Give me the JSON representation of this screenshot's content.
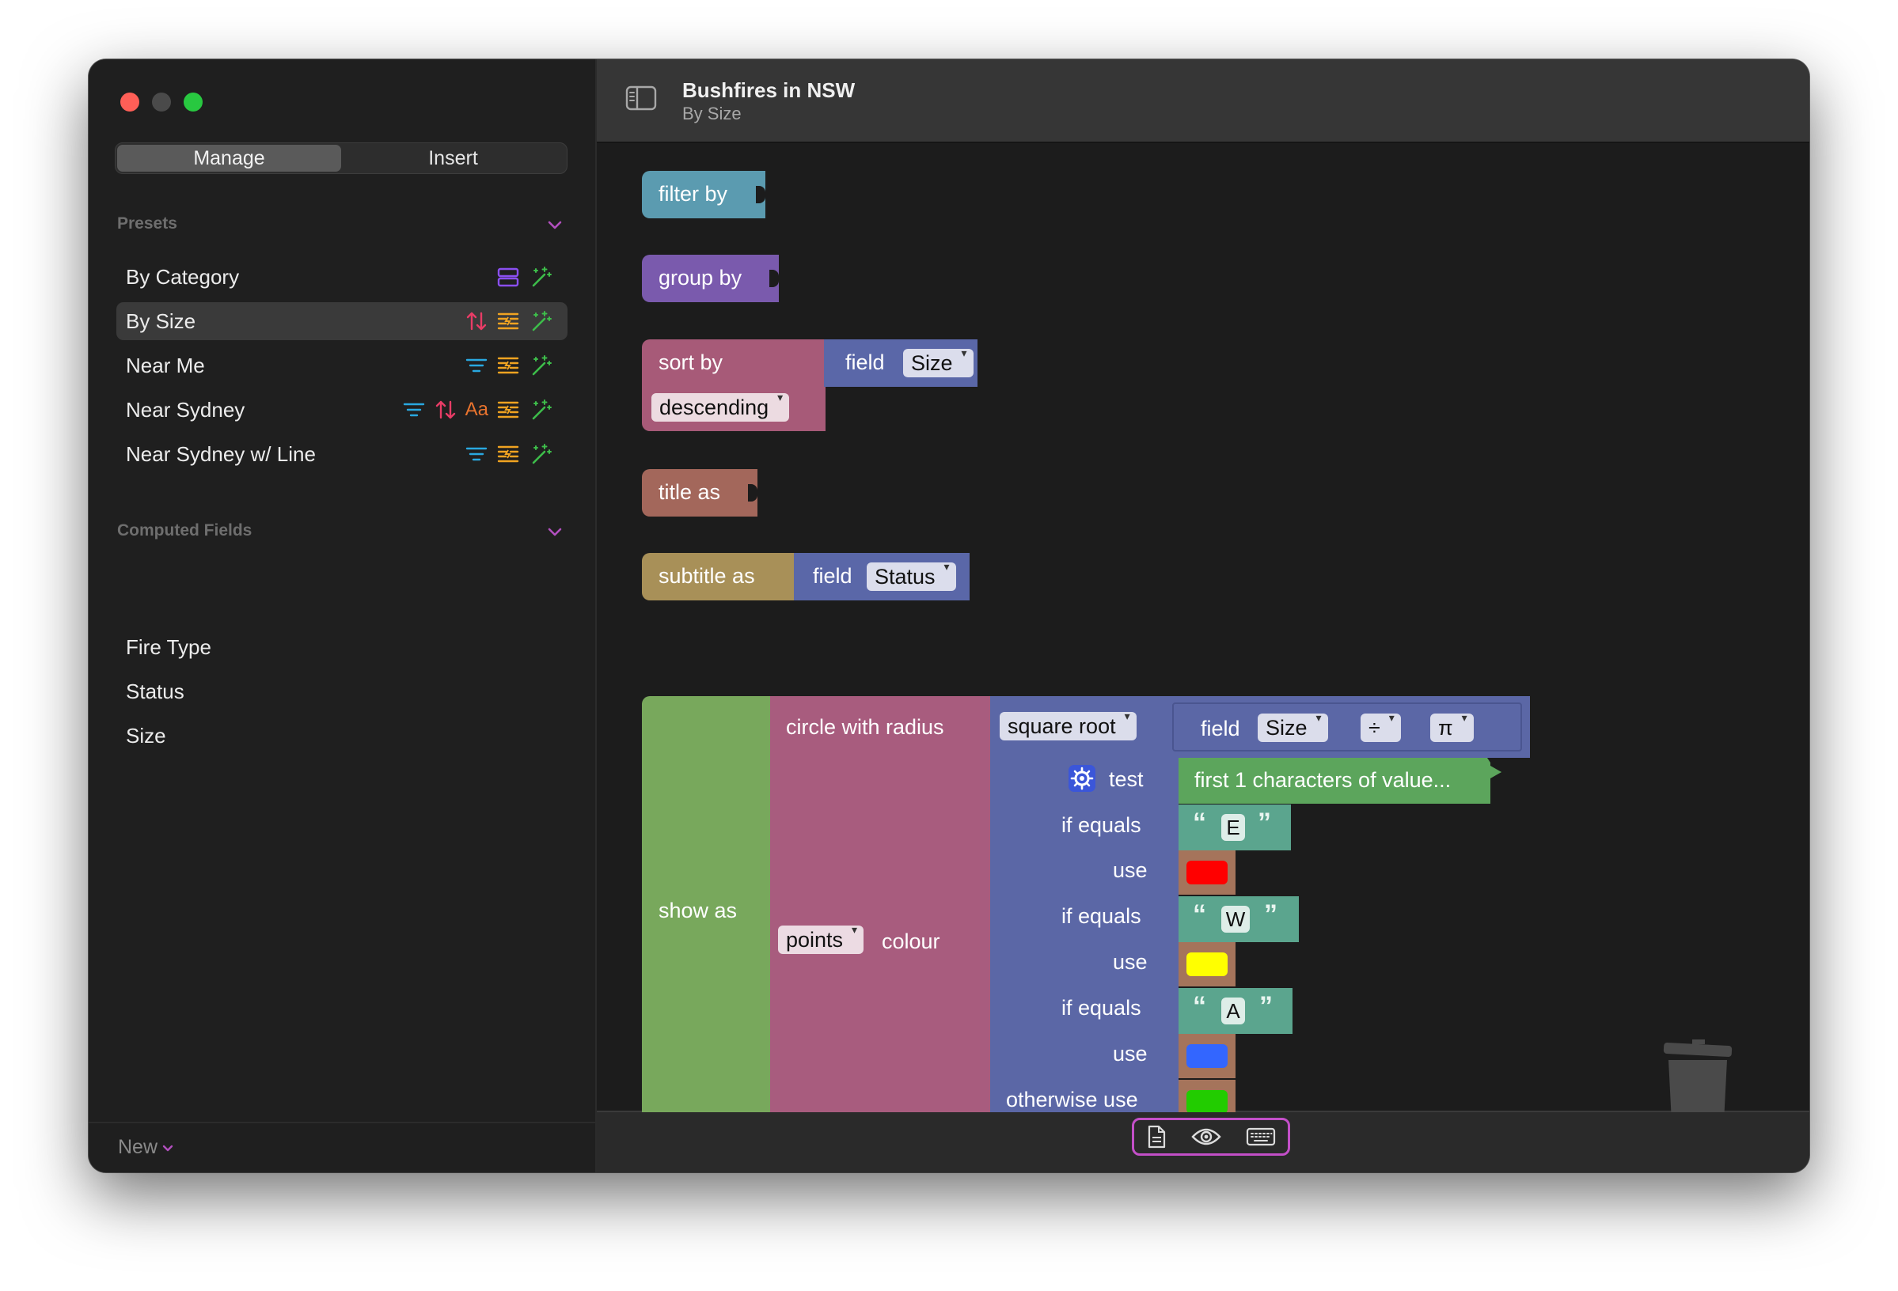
{
  "window": {
    "title": "Bushfires in NSW",
    "subtitle": "By Size"
  },
  "sidebar": {
    "tabs": [
      {
        "label": "Manage",
        "active": true
      },
      {
        "label": "Insert",
        "active": false
      }
    ],
    "presets_header": "Presets",
    "presets": [
      {
        "label": "By Category",
        "icons": [
          "layers-icon",
          "magic-wand-icon"
        ]
      },
      {
        "label": "By Size",
        "icons": [
          "sort-icon",
          "list-format-icon",
          "magic-wand-icon"
        ],
        "selected": true
      },
      {
        "label": "Near Me",
        "icons": [
          "filter-lines-icon",
          "list-format-icon",
          "magic-wand-icon"
        ]
      },
      {
        "label": "Near Sydney",
        "icons": [
          "filter-lines-icon",
          "sort-icon",
          "text-aa-icon",
          "list-format-icon",
          "magic-wand-icon"
        ],
        "aa": "Aa"
      },
      {
        "label": "Near Sydney w/ Line",
        "icons": [
          "filter-lines-icon",
          "list-format-icon",
          "magic-wand-icon"
        ]
      }
    ],
    "computed_header": "Computed Fields",
    "computed": [
      {
        "label": "Fire Type"
      },
      {
        "label": "Status"
      },
      {
        "label": "Size"
      }
    ],
    "new_label": "New"
  },
  "blocks": {
    "filter": {
      "label": "filter by"
    },
    "group": {
      "label": "group by"
    },
    "sort": {
      "label": "sort by",
      "field_label": "field",
      "field_value": "Size",
      "order": "descending"
    },
    "title": {
      "label": "title as"
    },
    "subtitle": {
      "label": "subtitle as",
      "field_label": "field",
      "field_value": "Status"
    },
    "show": {
      "label": "show as",
      "circle_label": "circle with radius",
      "sqrt_label": "square root",
      "field_label": "field",
      "field_value": "Size",
      "op": "÷",
      "constant": "π",
      "points_label": "points",
      "colour_label": "colour",
      "test_label": "test",
      "test_value": "first 1 characters of value...",
      "open_quote": "“",
      "close_quote": "”",
      "cases": [
        {
          "if_label": "if equals",
          "value": "E",
          "use_label": "use",
          "color": "#ff0000"
        },
        {
          "if_label": "if equals",
          "value": "W",
          "use_label": "use",
          "color": "#ffff00"
        },
        {
          "if_label": "if equals",
          "value": "A",
          "use_label": "use",
          "color": "#3366ff"
        }
      ],
      "otherwise_label": "otherwise use",
      "otherwise_color": "#22cc00"
    }
  },
  "colors": {
    "filter": "#5b9bb0",
    "group": "#7a5aad",
    "sort": "#a75a78",
    "field": "#5a67a8",
    "title": "#a3675b",
    "subtitle": "#a89058",
    "show": "#78a85c",
    "circle": "#a85c7e",
    "math": "#5b67a6",
    "text": "#5ba58e",
    "test": "#5ca55c",
    "colour_block": "#a5745b",
    "accent": "#c34fc8"
  }
}
